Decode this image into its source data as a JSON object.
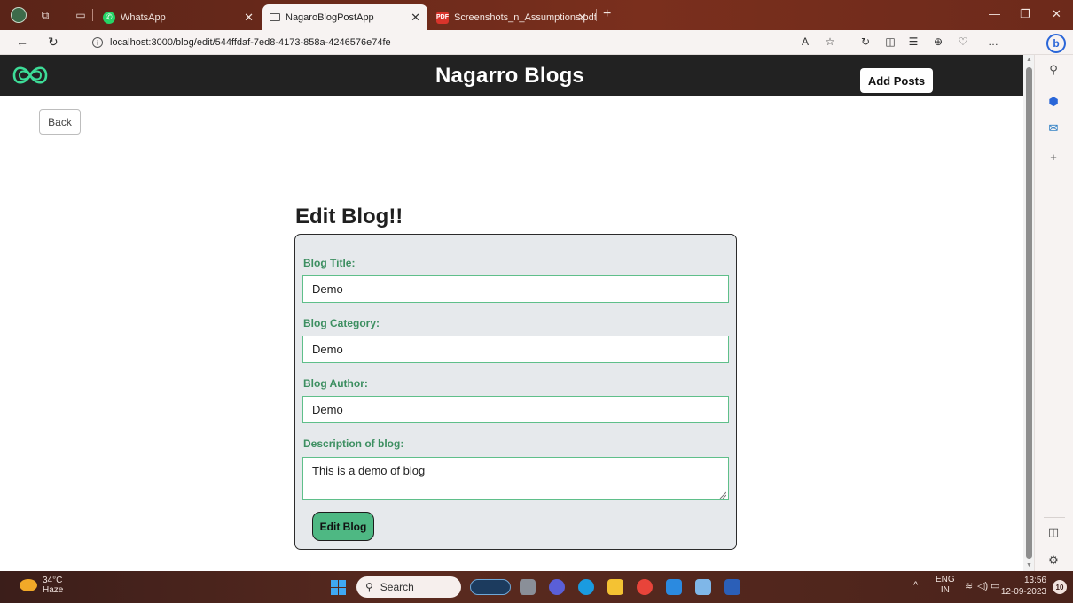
{
  "browser": {
    "tabs": [
      {
        "label": "WhatsApp",
        "icon": "whatsapp-icon"
      },
      {
        "label": "NagaroBlogPostApp",
        "icon": "page-icon",
        "active": true
      },
      {
        "label": "Screenshots_n_Assumptions.pdf",
        "icon": "pdf-icon"
      }
    ],
    "url": "localhost:3000/blog/edit/544ffdaf-7ed8-4173-858a-4246576e74fe"
  },
  "app": {
    "title": "Nagarro Blogs",
    "add_posts_label": "Add Posts",
    "back_label": "Back",
    "brand_color": "#3ddc97",
    "header_color": "#222222"
  },
  "form": {
    "heading": "Edit Blog!!",
    "fields": [
      {
        "label": "Blog Title:",
        "value": "Demo"
      },
      {
        "label": "Blog Category:",
        "value": "Demo"
      },
      {
        "label": "Blog Author:",
        "value": "Demo"
      }
    ],
    "description": {
      "label": "Description of blog:",
      "value": "This is a demo of blog"
    },
    "submit_label": "Edit Blog",
    "label_color": "#3d8f61",
    "button_color": "#4eb883"
  },
  "taskbar": {
    "temperature": "34°C",
    "weather": "Haze",
    "search_placeholder": "Search",
    "language": "ENG",
    "region": "IN",
    "time": "13:56",
    "date": "12-09-2023",
    "notification_count": "10"
  }
}
